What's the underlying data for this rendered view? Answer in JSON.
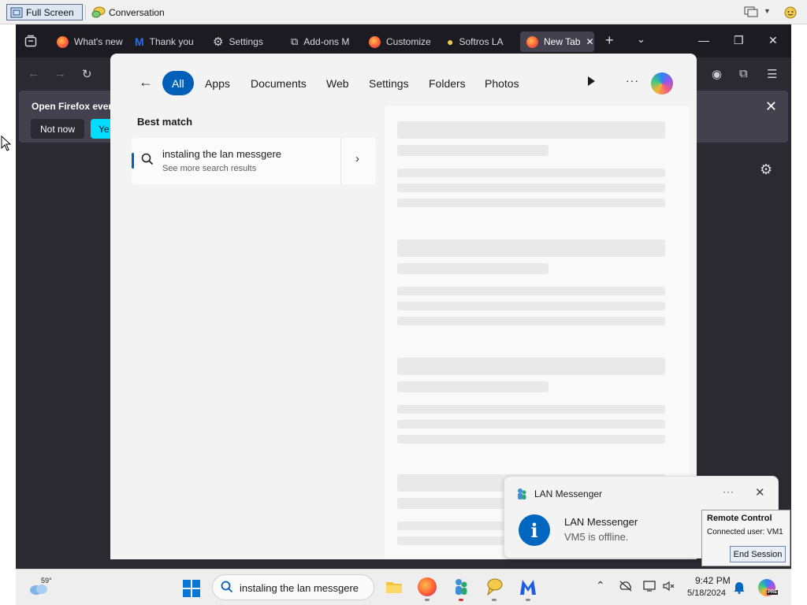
{
  "toolbar": {
    "full_screen_label": "Full Screen",
    "conversation_label": "Conversation"
  },
  "browser": {
    "tabs": [
      {
        "label": "What's new",
        "icon": "firefox-icon"
      },
      {
        "label": "Thank you",
        "icon": "malwarebytes-icon"
      },
      {
        "label": "Settings",
        "icon": "gear-icon"
      },
      {
        "label": "Add-ons M",
        "icon": "puzzle-icon"
      },
      {
        "label": "Customize",
        "icon": "firefox-icon"
      },
      {
        "label": "Softros LA",
        "icon": "chat-bubble-icon"
      },
      {
        "label": "New Tab",
        "icon": "firefox-icon",
        "active": true
      }
    ],
    "notification": {
      "text": "Open Firefox ever",
      "not_now_label": "Not now",
      "yes_label": "Ye"
    }
  },
  "search": {
    "filters": [
      "All",
      "Apps",
      "Documents",
      "Web",
      "Settings",
      "Folders",
      "Photos"
    ],
    "active_filter": "All",
    "best_match_label": "Best match",
    "result": {
      "title": "instaling the lan messgere",
      "subtitle": "See more search results"
    }
  },
  "toast": {
    "app_name": "LAN Messenger",
    "title": "LAN Messenger",
    "body": "VM5 is offline."
  },
  "remote_control": {
    "title": "Remote Control",
    "connected_user": "Connected user: VM1",
    "end_session_label": "End Session"
  },
  "taskbar": {
    "weather_temp": "59°",
    "search_text": "instaling the lan messgere",
    "time": "9:42 PM",
    "date": "5/18/2024",
    "copilot_badge": "PRE"
  },
  "colors": {
    "accent": "#005fb8",
    "firefox_dark": "#2b2a33",
    "notification_button": "#00ddff",
    "toast_info": "#0067c0"
  }
}
